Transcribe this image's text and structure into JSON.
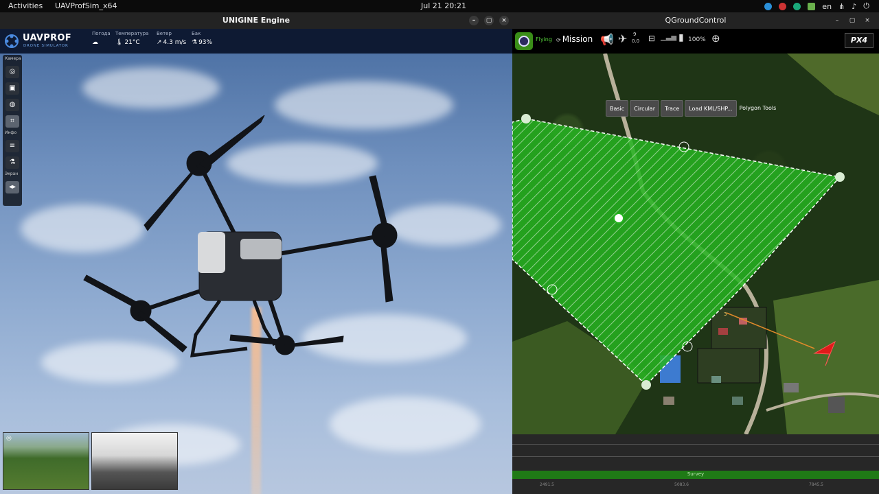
{
  "topbar": {
    "activities": "Activities",
    "app": "UAVProfSim_x64",
    "clock": "Jul 21  20:21",
    "lang": "en"
  },
  "unigine": {
    "title": "UNIGINE Engine",
    "logo": {
      "name": "UAVPROF",
      "sub": "DRONE SIMULATOR"
    },
    "hud": [
      {
        "label": "Погода",
        "value": "",
        "icon": "cloud-sun-icon"
      },
      {
        "label": "Температура",
        "value": "21°C",
        "icon": "thermometer-icon"
      },
      {
        "label": "Ветер",
        "value": "4.3 m/s",
        "icon": "wind-arrow-icon"
      },
      {
        "label": "Бак",
        "value": "93%",
        "icon": "flask-icon"
      }
    ],
    "side": {
      "camera": "Камера",
      "info": "Инфо",
      "screen": "Экран"
    }
  },
  "qgc": {
    "title": "QGroundControl",
    "status": "Flying",
    "mode": "Mission",
    "gps": {
      "count": "9",
      "hdop": "0.0"
    },
    "battery": "100%",
    "brand": "PX4",
    "polygon_tools": {
      "buttons": [
        "Basic",
        "Circular",
        "Trace",
        "Load KML/SHP..."
      ],
      "label": "Polygon Tools"
    },
    "waypoint_label": "3",
    "timeline": {
      "label": "Survey",
      "ticks": [
        "2491.5",
        "5083.6",
        "7845.5"
      ]
    }
  },
  "colors": {
    "qgc_green": "#3a8e18",
    "polygon_fill": "#2fd42a",
    "hud_bg": "#0e1a33",
    "flying": "#56d33a"
  }
}
